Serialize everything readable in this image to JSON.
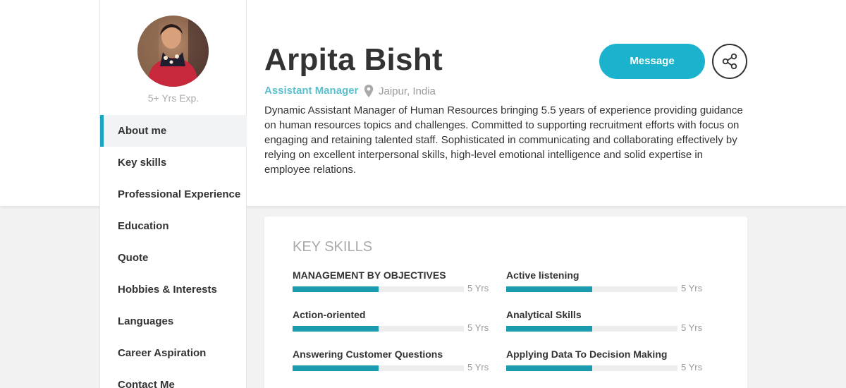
{
  "sidebar": {
    "experience": "5+ Yrs Exp.",
    "nav": [
      {
        "label": "About me",
        "active": true
      },
      {
        "label": "Key skills"
      },
      {
        "label": "Professional Experience"
      },
      {
        "label": "Education"
      },
      {
        "label": "Quote"
      },
      {
        "label": "Hobbies & Interests"
      },
      {
        "label": "Languages"
      },
      {
        "label": "Career Aspiration"
      },
      {
        "label": "Contact Me"
      }
    ]
  },
  "profile": {
    "name": "Arpita Bisht",
    "role": "Assistant Manager",
    "location": "Jaipur, India",
    "bio": "Dynamic Assistant Manager of Human Resources bringing 5.5 years of experience providing guidance on human resources topics and challenges. Committed to supporting recruitment efforts with focus on engaging and retaining talented staff. Sophisticated in communicating and collaborating effectively by relying on excellent interpersonal skills, high-level emotional intelligence and solid expertise in employee relations."
  },
  "actions": {
    "message_label": "Message"
  },
  "skills_card": {
    "title": "KEY SKILLS",
    "skills": [
      {
        "name": "MANAGEMENT BY OBJECTIVES",
        "years": "5 Yrs",
        "level": 0.5
      },
      {
        "name": "Active listening",
        "years": "5 Yrs",
        "level": 0.5
      },
      {
        "name": "Action-oriented",
        "years": "5 Yrs",
        "level": 0.5
      },
      {
        "name": "Analytical Skills",
        "years": "5 Yrs",
        "level": 0.5
      },
      {
        "name": "Answering Customer Questions",
        "years": "5 Yrs",
        "level": 0.5
      },
      {
        "name": "Applying Data To Decision Making",
        "years": "5 Yrs",
        "level": 0.5
      }
    ]
  },
  "colors": {
    "accent": "#1ab2cd",
    "role_text": "#5bbfcf",
    "bar_fill": "#1a9cae",
    "nav_active_bg": "#f2f3f5"
  },
  "icons": {
    "location": "map-pin-icon",
    "share": "share-icon"
  }
}
